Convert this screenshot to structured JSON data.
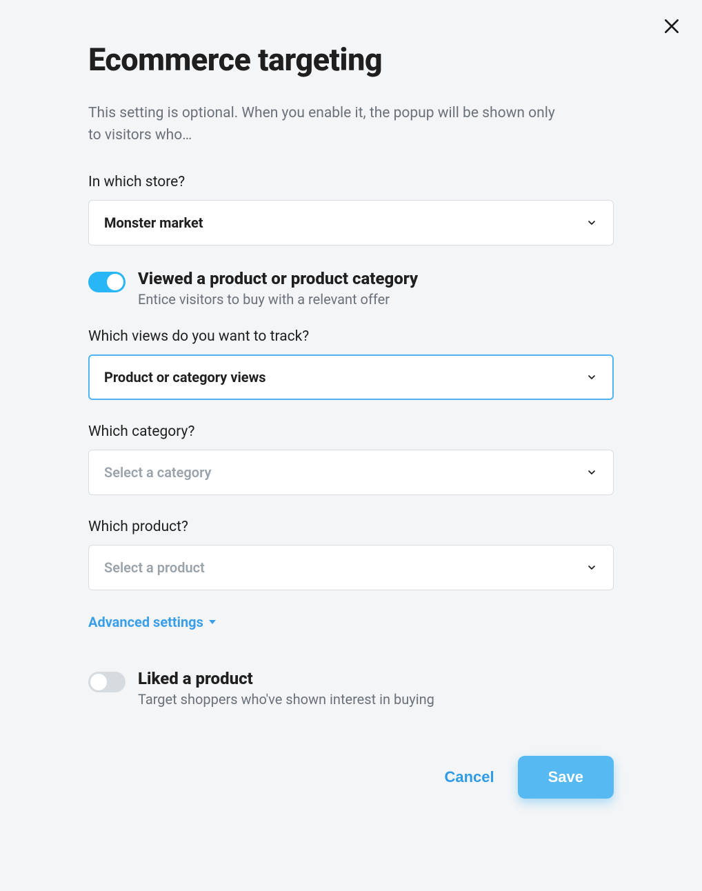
{
  "title": "Ecommerce targeting",
  "description": "This setting is optional. When you enable it, the popup will be shown only to visitors who…",
  "store": {
    "label": "In which store?",
    "value": "Monster market"
  },
  "viewed": {
    "title": "Viewed a product or product category",
    "subtitle": "Entice visitors to buy with a relevant offer"
  },
  "views": {
    "label": "Which views do you want to track?",
    "value": "Product or category views"
  },
  "category": {
    "label": "Which category?",
    "placeholder": "Select a category"
  },
  "product": {
    "label": "Which product?",
    "placeholder": "Select a product"
  },
  "advanced": "Advanced settings",
  "liked": {
    "title": "Liked a product",
    "subtitle": "Target shoppers who've shown interest in buying"
  },
  "buttons": {
    "cancel": "Cancel",
    "save": "Save"
  }
}
